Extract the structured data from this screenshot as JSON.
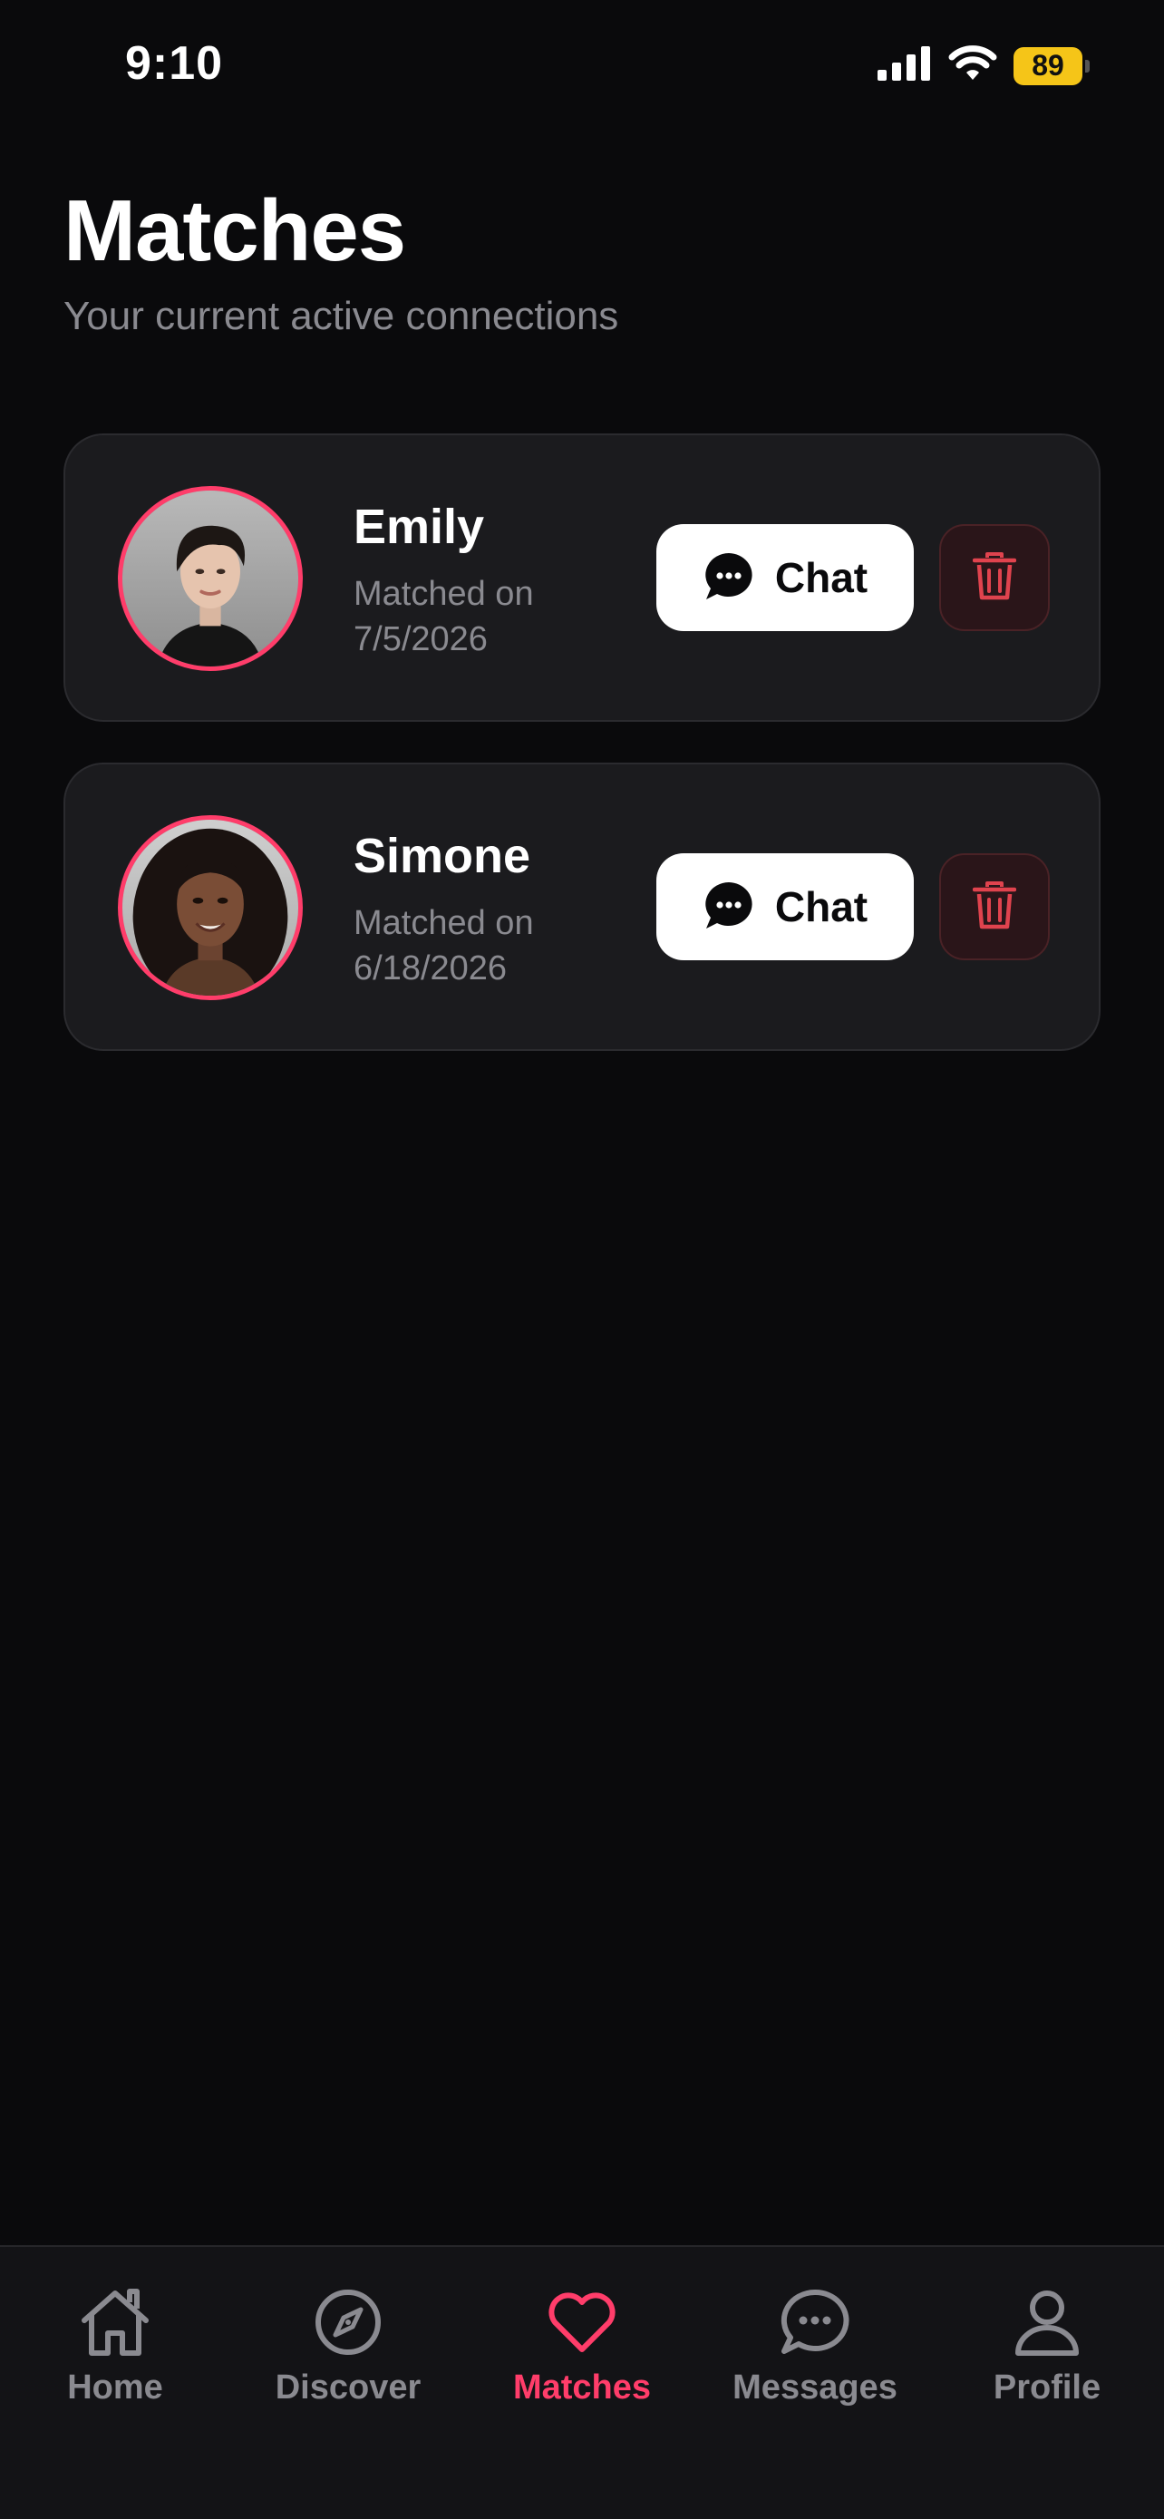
{
  "status_bar": {
    "time": "9:10",
    "battery": "89"
  },
  "header": {
    "title": "Matches",
    "subtitle": "Your current active connections"
  },
  "matches": [
    {
      "name": "Emily",
      "matched_label": "Matched on 7/5/2026",
      "chat_label": "Chat"
    },
    {
      "name": "Simone",
      "matched_label": "Matched on 6/18/2026",
      "chat_label": "Chat"
    }
  ],
  "bottom_nav": {
    "items": [
      {
        "label": "Home",
        "icon": "home-icon"
      },
      {
        "label": "Discover",
        "icon": "compass-icon"
      },
      {
        "label": "Matches",
        "icon": "heart-icon",
        "active": true
      },
      {
        "label": "Messages",
        "icon": "chat-bubble-icon"
      },
      {
        "label": "Profile",
        "icon": "person-icon"
      }
    ]
  },
  "colors": {
    "accent": "#ff3d6a",
    "background": "#0a0a0c",
    "card": "#1b1b1e",
    "muted_text": "#8a8a90",
    "battery": "#f5c518",
    "delete": "#e0434e"
  }
}
